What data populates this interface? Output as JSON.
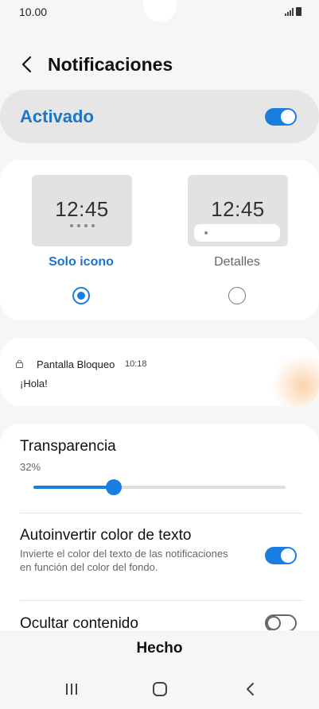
{
  "status": {
    "time": "10.00"
  },
  "header": {
    "title": "Notificaciones"
  },
  "master": {
    "label": "Activado",
    "enabled": true
  },
  "styles": {
    "preview_time": "12:45",
    "options": [
      {
        "label": "Solo icono",
        "selected": true
      },
      {
        "label": "Detalles",
        "selected": false
      }
    ]
  },
  "notification_preview": {
    "app": "Pantalla Bloqueo",
    "time": "10:18",
    "message": "¡Hola!"
  },
  "settings": {
    "transparency": {
      "title": "Transparencia",
      "value_label": "32%",
      "value": 0.32
    },
    "auto_invert": {
      "title": "Autoinvertir color de texto",
      "description": "Invierte el color del texto de las notificaciones en función del color del fondo.",
      "enabled": true
    },
    "hide_content": {
      "title": "Ocultar contenido",
      "enabled": false
    }
  },
  "footer": {
    "done_label": "Hecho"
  },
  "colors": {
    "accent": "#1a7de0",
    "accent_text": "#1e74c6"
  }
}
